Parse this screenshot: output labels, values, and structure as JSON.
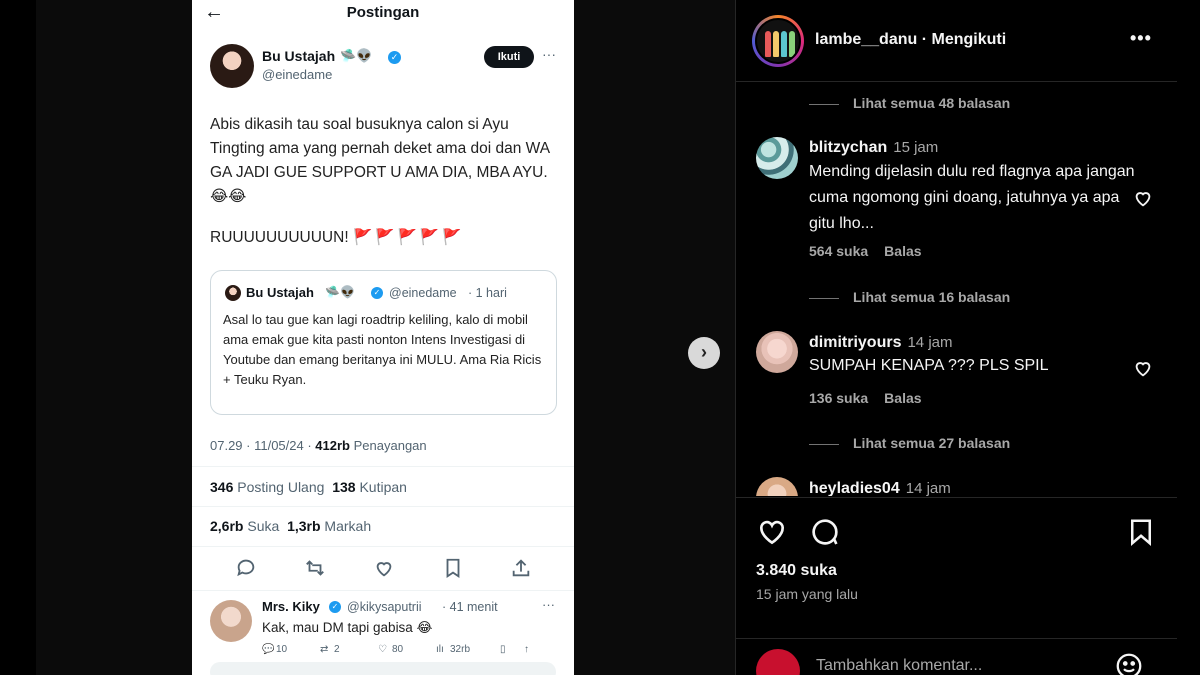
{
  "tweet": {
    "header_title": "Postingan",
    "back_icon": "←",
    "author_name": "Bu Ustajah",
    "author_emoji": "🛸👽",
    "author_handle": "@einedame",
    "follow_label": "Ikuti",
    "more_icon": "···",
    "body_text": "Abis dikasih tau soal busuknya calon si Ayu Tingting ama yang pernah deket ama doi dan WA GA JADI GUE SUPPORT U AMA DIA, MBA AYU. 😂😂",
    "body_shout": "RUUUUUUUUUUN!",
    "body_flags": "🚩🚩🚩🚩🚩",
    "quote": {
      "name": "Bu Ustajah",
      "emoji": "🛸👽",
      "handle": "@einedame",
      "time": "· 1 hari",
      "text": "Asal lo tau gue kan lagi roadtrip keliling, kalo di mobil ama emak gue kita pasti nonton Intens Investigasi di Youtube dan emang beritanya ini MULU. Ama Ria Ricis + Teuku Ryan."
    },
    "meta_time": "07.29 · 11/05/24 ·",
    "views_count": "412rb",
    "views_label": "Penayangan",
    "reposts_count": "346",
    "reposts_label": "Posting Ulang",
    "quotes_count": "138",
    "quotes_label": "Kutipan",
    "likes_count": "2,6rb",
    "likes_label": "Suka",
    "bookmarks_count": "1,3rb",
    "bookmarks_label": "Markah",
    "reply": {
      "name": "Mrs. Kiky",
      "handle": "@kikysaputrii",
      "time": "· 41 menit",
      "text": "Kak, mau DM tapi gabisa 😂",
      "reply_count": "10",
      "repost_count": "2",
      "like_count": "80",
      "views_count": "32rb"
    }
  },
  "instagram": {
    "username": "lambe__danu",
    "follow_status": "· Mengikuti",
    "more_icon": "•••",
    "comments": [
      {
        "view_replies": "Lihat semua 48 balasan"
      },
      {
        "user": "blitzychan",
        "time": "15 jam",
        "text": "Mending dijelasin dulu red flagnya apa jangan cuma ngomong gini doang, jatuhnya ya apa gitu lho...",
        "likes": "564 suka",
        "reply": "Balas"
      },
      {
        "view_replies": "Lihat semua 16 balasan"
      },
      {
        "user": "dimitriyours",
        "time": "14 jam",
        "text": "SUMPAH KENAPA ??? PLS SPIL",
        "likes": "136 suka",
        "reply": "Balas"
      },
      {
        "view_replies": "Lihat semua 27 balasan"
      },
      {
        "user": "heyladies04",
        "time": "14 jam"
      }
    ],
    "likes": "3.840 suka",
    "posted_time": "15 jam yang lalu",
    "add_comment_placeholder": "Tambahkan komentar..."
  },
  "colors": {
    "ig_background": "#000000",
    "tweet_background": "#ffffff",
    "verified_blue": "#1d9bf0",
    "flag_red": "#c0392b"
  }
}
